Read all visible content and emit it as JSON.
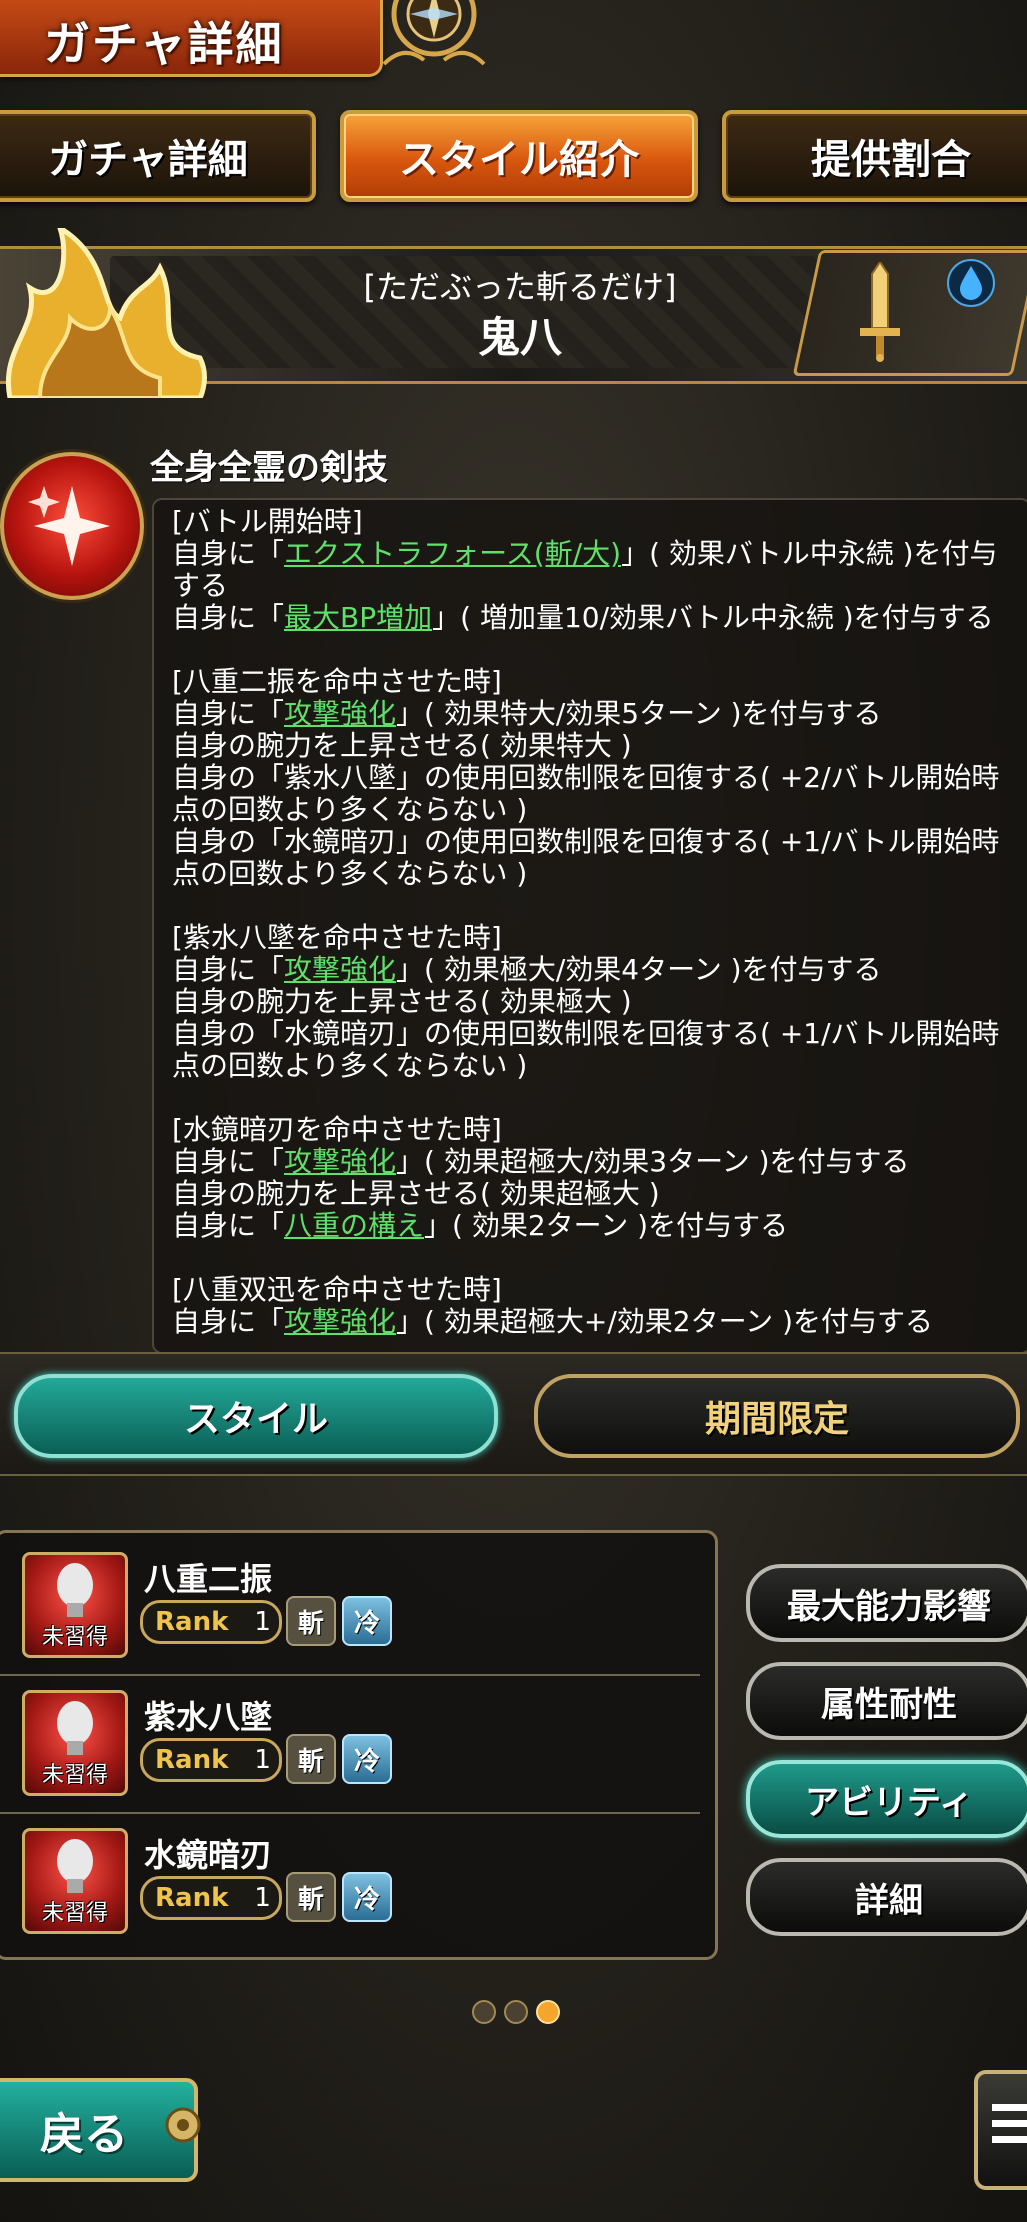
{
  "header": {
    "title": "ガチャ詳細"
  },
  "tabs": [
    {
      "label": "ガチャ詳細"
    },
    {
      "label": "スタイル紹介"
    },
    {
      "label": "提供割合"
    }
  ],
  "style": {
    "subtitle": "[ただぶった斬るだけ]",
    "name": "鬼八"
  },
  "skill": {
    "title": "全身全霊の剣技",
    "lines": [
      {
        "t": "[バトル開始時]"
      },
      {
        "pre": "自身に「",
        "link": "エクストラフォース(斬/大)",
        "post": "」( 効果バトル中永続 )を付与"
      },
      {
        "t": "する"
      },
      {
        "pre": "自身に「",
        "link": "最大BP増加",
        "post": "」( 増加量10/効果バトル中永続 )を付与する"
      },
      {
        "t": ""
      },
      {
        "t": "[八重二振を命中させた時]"
      },
      {
        "pre": "自身に「",
        "link": "攻撃強化",
        "post": "」( 効果特大/効果5ターン )を付与する"
      },
      {
        "t": "自身の腕力を上昇させる( 効果特大 )"
      },
      {
        "t": "自身の「紫水八墜」の使用回数制限を回復する( +2/バトル開始時"
      },
      {
        "t": "点の回数より多くならない )"
      },
      {
        "t": "自身の「水鏡暗刃」の使用回数制限を回復する( +1/バトル開始時"
      },
      {
        "t": "点の回数より多くならない )"
      },
      {
        "t": ""
      },
      {
        "t": "[紫水八墜を命中させた時]"
      },
      {
        "pre": "自身に「",
        "link": "攻撃強化",
        "post": "」( 効果極大/効果4ターン )を付与する"
      },
      {
        "t": "自身の腕力を上昇させる( 効果極大 )"
      },
      {
        "t": "自身の「水鏡暗刃」の使用回数制限を回復する( +1/バトル開始時"
      },
      {
        "t": "点の回数より多くならない )"
      },
      {
        "t": ""
      },
      {
        "t": "[水鏡暗刃を命中させた時]"
      },
      {
        "pre": "自身に「",
        "link": "攻撃強化",
        "post": "」( 効果超極大/効果3ターン )を付与する"
      },
      {
        "t": "自身の腕力を上昇させる( 効果超極大 )"
      },
      {
        "pre": "自身に「",
        "link": "八重の構え",
        "post": "」( 効果2ターン )を付与する"
      },
      {
        "t": ""
      },
      {
        "t": "[八重双迅を命中させた時]"
      },
      {
        "pre": "自身に「",
        "link": "攻撃強化",
        "post": "」( 効果超極大+/効果2ターン )を付与する"
      }
    ]
  },
  "filters": {
    "style_label": "スタイル",
    "limited_label": "期間限定"
  },
  "abilities": [
    {
      "name": "八重二振",
      "status": "未習得",
      "rank_label": "Rank",
      "rank": "1",
      "elem1": "斬",
      "elem2": "冷"
    },
    {
      "name": "紫水八墜",
      "status": "未習得",
      "rank_label": "Rank",
      "rank": "1",
      "elem1": "斬",
      "elem2": "冷"
    },
    {
      "name": "水鏡暗刃",
      "status": "未習得",
      "rank_label": "Rank",
      "rank": "1",
      "elem1": "斬",
      "elem2": "冷"
    }
  ],
  "side_buttons": [
    {
      "label": "最大能力影響"
    },
    {
      "label": "属性耐性"
    },
    {
      "label": "アビリティ"
    },
    {
      "label": "詳細"
    }
  ],
  "pagination": {
    "count": 3,
    "active": 3
  },
  "back_label": "戻る",
  "colors": {
    "accent_gold": "#c99a3e",
    "active_tab": "#e06a14",
    "teal": "#1f9a8a",
    "link_green": "#5fe06a"
  }
}
